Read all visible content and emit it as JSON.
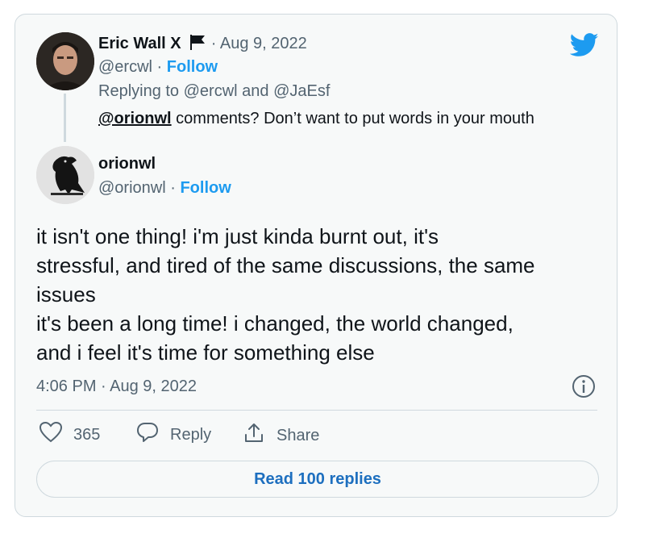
{
  "parent_tweet": {
    "author_name": "Eric Wall X",
    "date_separator": "·",
    "date": "Aug 9, 2022",
    "handle": "@ercwl",
    "dot": "·",
    "follow_label": "Follow",
    "replying_to": "Replying to @ercwl and @JaEsf",
    "mention": "@orionwl",
    "text": " comments? Don’t want to put words in your mouth"
  },
  "tweet": {
    "author_name": "orionwl",
    "handle": "@orionwl",
    "dot": "·",
    "follow_label": "Follow",
    "lines": [
      "it isn't one thing! i'm just kinda burnt out, it's",
      "stressful, and tired of the same discussions, the same",
      "issues",
      "it's been a long time! i changed, the world changed,",
      "and i feel it's time for something else"
    ],
    "timestamp": "4:06 PM · Aug 9, 2022"
  },
  "actions": {
    "like_count": "365",
    "reply_label": "Reply",
    "share_label": "Share"
  },
  "read_replies_label": "Read 100 replies",
  "colors": {
    "accent": "#1d9bf0",
    "text": "#0f1419",
    "muted": "#536471",
    "border": "#cfd9de",
    "card_bg": "#f7f9f9"
  },
  "icons": [
    "twitter-bird-icon",
    "flag-icon",
    "heart-icon",
    "reply-bubble-icon",
    "share-icon",
    "info-icon"
  ]
}
